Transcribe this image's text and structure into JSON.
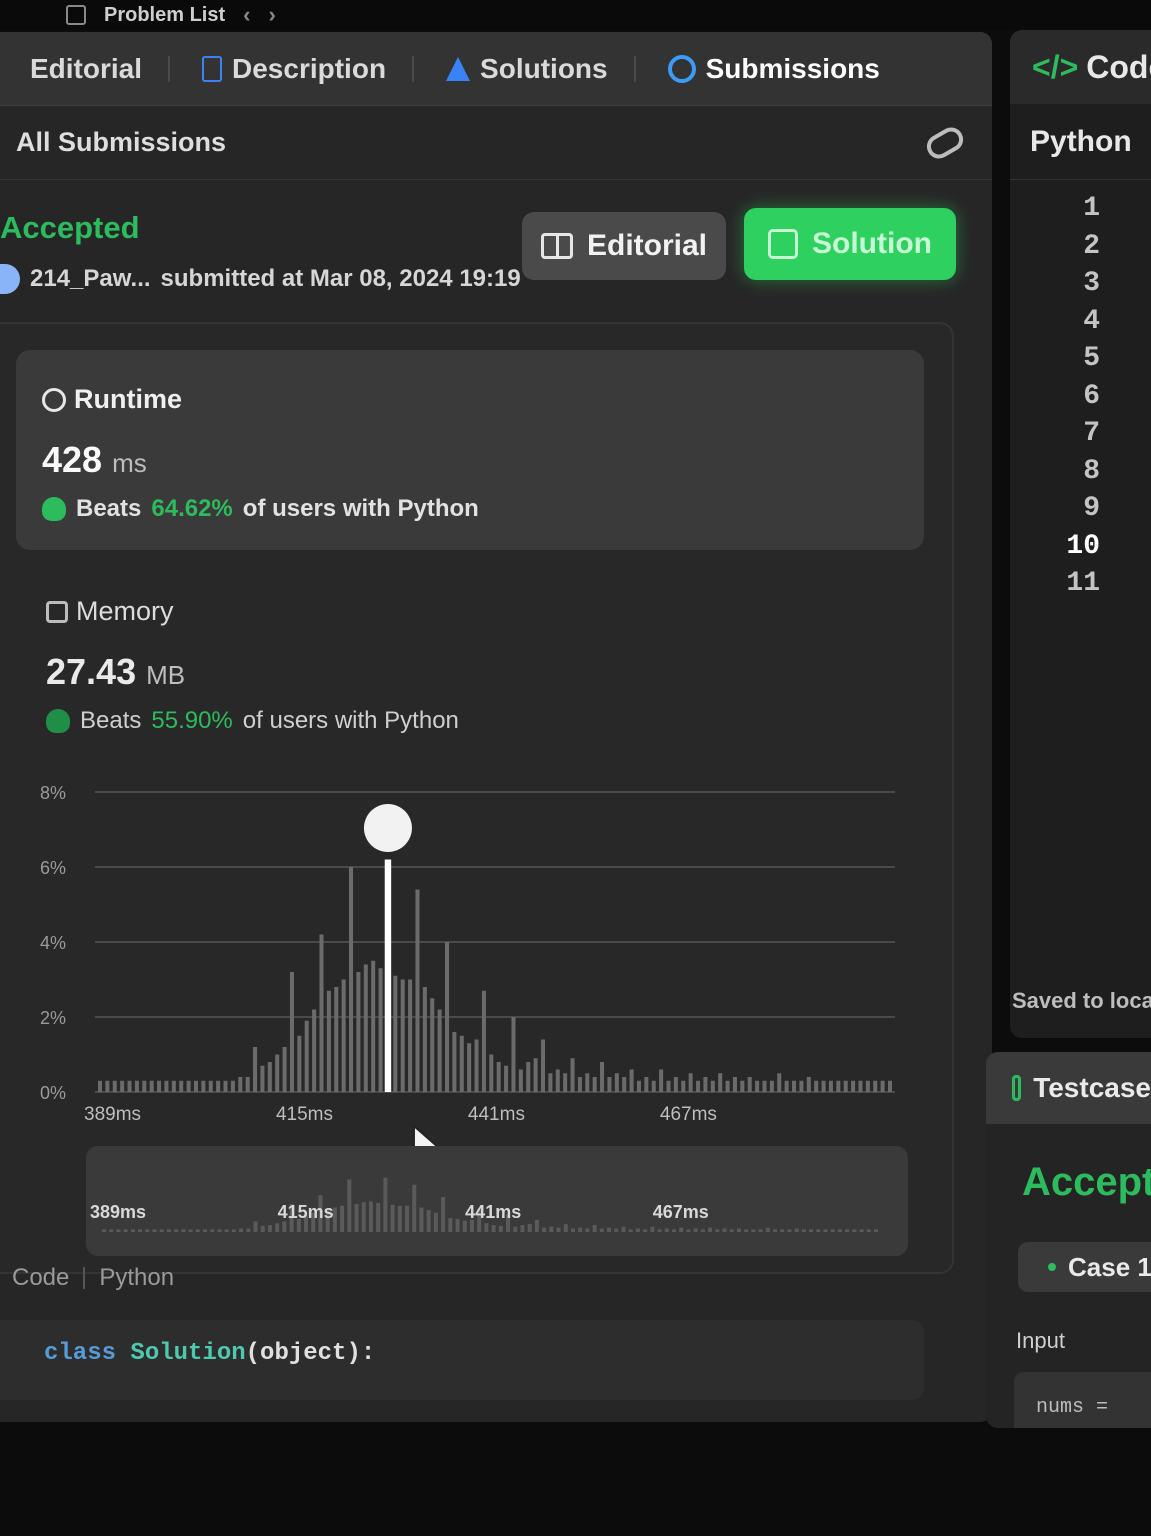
{
  "topbar": {
    "title": "Problem List",
    "prev": "‹",
    "next": "›"
  },
  "tabs": [
    {
      "label": "Editorial"
    },
    {
      "label": "Description"
    },
    {
      "label": "Solutions"
    },
    {
      "label": "Submissions"
    }
  ],
  "subheader": {
    "title": "All Submissions"
  },
  "submission": {
    "status": "Accepted",
    "user": "214_Paw...",
    "submitted": "submitted at Mar 08, 2024 19:19",
    "editorial_label": "Editorial",
    "solution_label": "Solution"
  },
  "runtime": {
    "label": "Runtime",
    "value": "428",
    "unit": "ms",
    "beats_prefix": "Beats",
    "beats_pct": "64.62%",
    "beats_suffix": "of users with Python"
  },
  "memory": {
    "label": "Memory",
    "value": "27.43",
    "unit": "MB",
    "beats_prefix": "Beats",
    "beats_pct": "55.90%",
    "beats_suffix": "of users with Python"
  },
  "chart_data": {
    "type": "bar",
    "y_ticks": [
      "0%",
      "2%",
      "4%",
      "6%",
      "8%"
    ],
    "ylim": [
      0,
      8
    ],
    "x_ticks": [
      "389ms",
      "415ms",
      "441ms",
      "467ms"
    ],
    "x_tick_values": [
      389,
      415,
      441,
      467
    ],
    "xlim": [
      389,
      496
    ],
    "highlight_x": 428,
    "bars": [
      {
        "x": 389,
        "y": 0.3
      },
      {
        "x": 390,
        "y": 0.3
      },
      {
        "x": 391,
        "y": 0.3
      },
      {
        "x": 392,
        "y": 0.3
      },
      {
        "x": 393,
        "y": 0.3
      },
      {
        "x": 394,
        "y": 0.3
      },
      {
        "x": 395,
        "y": 0.3
      },
      {
        "x": 396,
        "y": 0.3
      },
      {
        "x": 397,
        "y": 0.3
      },
      {
        "x": 398,
        "y": 0.3
      },
      {
        "x": 399,
        "y": 0.3
      },
      {
        "x": 400,
        "y": 0.3
      },
      {
        "x": 401,
        "y": 0.3
      },
      {
        "x": 402,
        "y": 0.3
      },
      {
        "x": 403,
        "y": 0.3
      },
      {
        "x": 404,
        "y": 0.3
      },
      {
        "x": 405,
        "y": 0.3
      },
      {
        "x": 406,
        "y": 0.3
      },
      {
        "x": 407,
        "y": 0.3
      },
      {
        "x": 408,
        "y": 0.4
      },
      {
        "x": 409,
        "y": 0.4
      },
      {
        "x": 410,
        "y": 1.2
      },
      {
        "x": 411,
        "y": 0.7
      },
      {
        "x": 412,
        "y": 0.8
      },
      {
        "x": 413,
        "y": 1.0
      },
      {
        "x": 414,
        "y": 1.2
      },
      {
        "x": 415,
        "y": 3.2
      },
      {
        "x": 416,
        "y": 1.5
      },
      {
        "x": 417,
        "y": 1.9
      },
      {
        "x": 418,
        "y": 2.2
      },
      {
        "x": 419,
        "y": 4.2
      },
      {
        "x": 420,
        "y": 2.7
      },
      {
        "x": 421,
        "y": 2.8
      },
      {
        "x": 422,
        "y": 3.0
      },
      {
        "x": 423,
        "y": 6.0
      },
      {
        "x": 424,
        "y": 3.2
      },
      {
        "x": 425,
        "y": 3.4
      },
      {
        "x": 426,
        "y": 3.5
      },
      {
        "x": 427,
        "y": 3.3
      },
      {
        "x": 428,
        "y": 6.2
      },
      {
        "x": 429,
        "y": 3.1
      },
      {
        "x": 430,
        "y": 3.0
      },
      {
        "x": 431,
        "y": 3.0
      },
      {
        "x": 432,
        "y": 5.4
      },
      {
        "x": 433,
        "y": 2.8
      },
      {
        "x": 434,
        "y": 2.5
      },
      {
        "x": 435,
        "y": 2.2
      },
      {
        "x": 436,
        "y": 4.0
      },
      {
        "x": 437,
        "y": 1.6
      },
      {
        "x": 438,
        "y": 1.5
      },
      {
        "x": 439,
        "y": 1.3
      },
      {
        "x": 440,
        "y": 1.4
      },
      {
        "x": 441,
        "y": 2.7
      },
      {
        "x": 442,
        "y": 1.0
      },
      {
        "x": 443,
        "y": 0.8
      },
      {
        "x": 444,
        "y": 0.7
      },
      {
        "x": 445,
        "y": 2.0
      },
      {
        "x": 446,
        "y": 0.6
      },
      {
        "x": 447,
        "y": 0.8
      },
      {
        "x": 448,
        "y": 0.9
      },
      {
        "x": 449,
        "y": 1.4
      },
      {
        "x": 450,
        "y": 0.5
      },
      {
        "x": 451,
        "y": 0.6
      },
      {
        "x": 452,
        "y": 0.5
      },
      {
        "x": 453,
        "y": 0.9
      },
      {
        "x": 454,
        "y": 0.4
      },
      {
        "x": 455,
        "y": 0.5
      },
      {
        "x": 456,
        "y": 0.4
      },
      {
        "x": 457,
        "y": 0.8
      },
      {
        "x": 458,
        "y": 0.4
      },
      {
        "x": 459,
        "y": 0.5
      },
      {
        "x": 460,
        "y": 0.4
      },
      {
        "x": 461,
        "y": 0.6
      },
      {
        "x": 462,
        "y": 0.3
      },
      {
        "x": 463,
        "y": 0.4
      },
      {
        "x": 464,
        "y": 0.3
      },
      {
        "x": 465,
        "y": 0.6
      },
      {
        "x": 466,
        "y": 0.3
      },
      {
        "x": 467,
        "y": 0.4
      },
      {
        "x": 468,
        "y": 0.3
      },
      {
        "x": 469,
        "y": 0.5
      },
      {
        "x": 470,
        "y": 0.3
      },
      {
        "x": 471,
        "y": 0.4
      },
      {
        "x": 472,
        "y": 0.3
      },
      {
        "x": 473,
        "y": 0.5
      },
      {
        "x": 474,
        "y": 0.3
      },
      {
        "x": 475,
        "y": 0.4
      },
      {
        "x": 476,
        "y": 0.3
      },
      {
        "x": 477,
        "y": 0.4
      },
      {
        "x": 478,
        "y": 0.3
      },
      {
        "x": 479,
        "y": 0.3
      },
      {
        "x": 480,
        "y": 0.3
      },
      {
        "x": 481,
        "y": 0.5
      },
      {
        "x": 482,
        "y": 0.3
      },
      {
        "x": 483,
        "y": 0.3
      },
      {
        "x": 484,
        "y": 0.3
      },
      {
        "x": 485,
        "y": 0.4
      },
      {
        "x": 486,
        "y": 0.3
      },
      {
        "x": 487,
        "y": 0.3
      },
      {
        "x": 488,
        "y": 0.3
      },
      {
        "x": 489,
        "y": 0.3
      },
      {
        "x": 490,
        "y": 0.3
      },
      {
        "x": 491,
        "y": 0.3
      },
      {
        "x": 492,
        "y": 0.3
      },
      {
        "x": 493,
        "y": 0.3
      },
      {
        "x": 494,
        "y": 0.3
      },
      {
        "x": 495,
        "y": 0.3
      },
      {
        "x": 496,
        "y": 0.3
      }
    ],
    "colors": {
      "bar": "#6b6b6b",
      "highlight": "#ffffff",
      "grid": "#4a4a4a"
    }
  },
  "code": {
    "label": "Code",
    "lang": "Python",
    "line1_kw": "class",
    "line1_cls": "Solution",
    "line1_rest": "(object):"
  },
  "editor": {
    "tab": "Code",
    "lang": "Python",
    "line_numbers": [
      "1",
      "2",
      "3",
      "4",
      "5",
      "6",
      "7",
      "8",
      "9",
      "10",
      "11"
    ],
    "saved": "Saved to local"
  },
  "testcase": {
    "tab": "Testcase",
    "status": "Accepted",
    "case": "Case 1",
    "input_label": "Input",
    "input_value": "nums ="
  },
  "colors": {
    "accent_green": "#2cbb5d",
    "accent_blue": "#3b9cf6",
    "panel": "#262626"
  }
}
